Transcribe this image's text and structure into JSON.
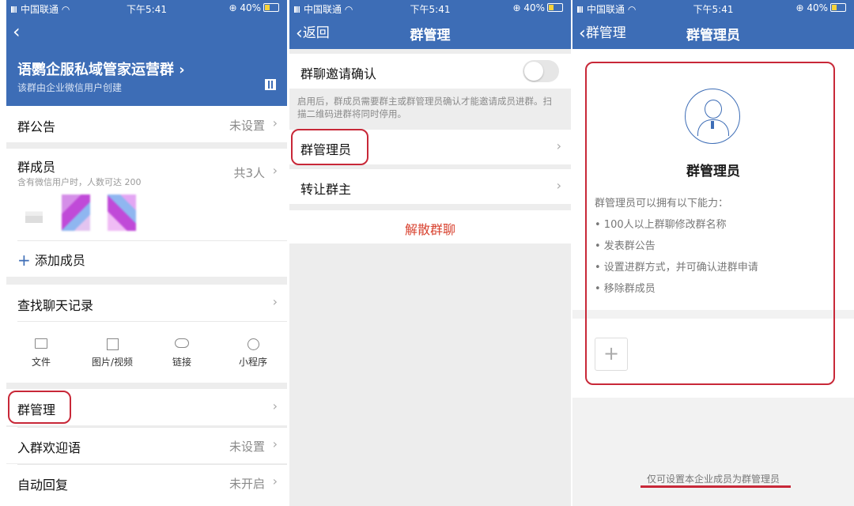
{
  "status": {
    "carrier": "中国联通",
    "time": "下午5:41",
    "battery": "40%"
  },
  "colors": {
    "accent": "#3d6db6",
    "danger": "#d8422f",
    "highlight": "#c82838"
  },
  "screen1": {
    "group_name": "语鹦企服私域管家运营群 ›",
    "created_by": "该群由企业微信用户创建",
    "announcement": {
      "label": "群公告",
      "value": "未设置"
    },
    "members": {
      "label": "群成员",
      "sub": "含有微信用户时，人数可达 200",
      "count": "共3人"
    },
    "add_member": "添加成员",
    "search_history": "查找聊天记录",
    "shortcuts": [
      {
        "label": "文件",
        "icon": "folder-icon"
      },
      {
        "label": "图片/视频",
        "icon": "image-icon"
      },
      {
        "label": "链接",
        "icon": "link-icon"
      },
      {
        "label": "小程序",
        "icon": "miniprogram-icon"
      }
    ],
    "manage": "群管理",
    "welcome": {
      "label": "入群欢迎语",
      "value": "未设置"
    },
    "auto_reply": {
      "label": "自动回复",
      "value": "未开启"
    }
  },
  "screen2": {
    "back": "返回",
    "title": "群管理",
    "invite_confirm": "群聊邀请确认",
    "invite_desc": "启用后，群成员需要群主或群管理员确认才能邀请成员进群。扫描二维码进群将同时停用。",
    "invite_enabled": false,
    "admin": "群管理员",
    "transfer": "转让群主",
    "dissolve": "解散群聊"
  },
  "screen3": {
    "back": "群管理",
    "title": "群管理员",
    "heading": "群管理员",
    "intro": "群管理员可以拥有以下能力：",
    "abilities": [
      "• 100人以上群聊修改群名称",
      "• 发表群公告",
      "• 设置进群方式，并可确认进群申请",
      "• 移除群成员"
    ],
    "footer_note": "仅可设置本企业成员为群管理员"
  }
}
